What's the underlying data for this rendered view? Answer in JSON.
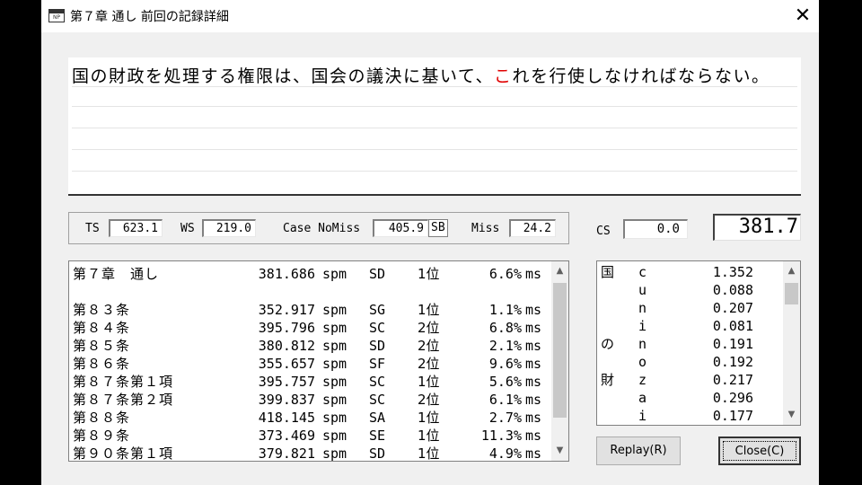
{
  "window": {
    "title": "第７章 通し 前回の記録詳細",
    "icon_label": "NP",
    "close_glyph": "✕"
  },
  "sentence": {
    "before": "国の財政を処理する権限は、国会の議決に基いて、",
    "highlight": "こ",
    "after": "れを行使しなければならない。"
  },
  "stats": {
    "ts_label": "TS",
    "ts_value": "623.1",
    "ws_label": "WS",
    "ws_value": "219.0",
    "case_label": "Case NoMiss",
    "case_value": "405.9",
    "case_suffix": "SB",
    "miss_label": "Miss",
    "miss_value": "24.2",
    "cs_label": "CS",
    "cs_value": "0.0",
    "score": "381.7"
  },
  "records": [
    {
      "name": "第７章　通し",
      "spm": "381.686",
      "unit": "spm",
      "rank": "SD",
      "pos": "1位",
      "pct": "6.6%",
      "ms": "ms"
    },
    {
      "name": "",
      "spm": "",
      "unit": "",
      "rank": "",
      "pos": "",
      "pct": "",
      "ms": ""
    },
    {
      "name": "第８３条",
      "spm": "352.917",
      "unit": "spm",
      "rank": "SG",
      "pos": "1位",
      "pct": "1.1%",
      "ms": "ms"
    },
    {
      "name": "第８４条",
      "spm": "395.796",
      "unit": "spm",
      "rank": "SC",
      "pos": "2位",
      "pct": "6.8%",
      "ms": "ms"
    },
    {
      "name": "第８５条",
      "spm": "380.812",
      "unit": "spm",
      "rank": "SD",
      "pos": "2位",
      "pct": "2.1%",
      "ms": "ms"
    },
    {
      "name": "第８６条",
      "spm": "355.657",
      "unit": "spm",
      "rank": "SF",
      "pos": "2位",
      "pct": "9.6%",
      "ms": "ms"
    },
    {
      "name": "第８７条第１項",
      "spm": "395.757",
      "unit": "spm",
      "rank": "SC",
      "pos": "1位",
      "pct": "5.6%",
      "ms": "ms"
    },
    {
      "name": "第８７条第２項",
      "spm": "399.837",
      "unit": "spm",
      "rank": "SC",
      "pos": "2位",
      "pct": "6.1%",
      "ms": "ms"
    },
    {
      "name": "第８８条",
      "spm": "418.145",
      "unit": "spm",
      "rank": "SA",
      "pos": "1位",
      "pct": "2.7%",
      "ms": "ms"
    },
    {
      "name": "第８９条",
      "spm": "373.469",
      "unit": "spm",
      "rank": "SE",
      "pos": "1位",
      "pct": "11.3%",
      "ms": "ms"
    },
    {
      "name": "第９０条第１項",
      "spm": "379.821",
      "unit": "spm",
      "rank": "SD",
      "pos": "1位",
      "pct": "4.9%",
      "ms": "ms"
    }
  ],
  "chars": [
    {
      "kanji": "国",
      "romaji": "c",
      "time": "1.352"
    },
    {
      "kanji": "",
      "romaji": "u",
      "time": "0.088"
    },
    {
      "kanji": "",
      "romaji": "n",
      "time": "0.207"
    },
    {
      "kanji": "",
      "romaji": "i",
      "time": "0.081"
    },
    {
      "kanji": "の",
      "romaji": "n",
      "time": "0.191"
    },
    {
      "kanji": "",
      "romaji": "o",
      "time": "0.192"
    },
    {
      "kanji": "財",
      "romaji": "z",
      "time": "0.217"
    },
    {
      "kanji": "",
      "romaji": "a",
      "time": "0.296"
    },
    {
      "kanji": "",
      "romaji": "i",
      "time": "0.177"
    }
  ],
  "scroll": {
    "up": "▲",
    "down": "▼"
  },
  "buttons": {
    "replay": "Replay(R)",
    "close": "Close(C)"
  }
}
